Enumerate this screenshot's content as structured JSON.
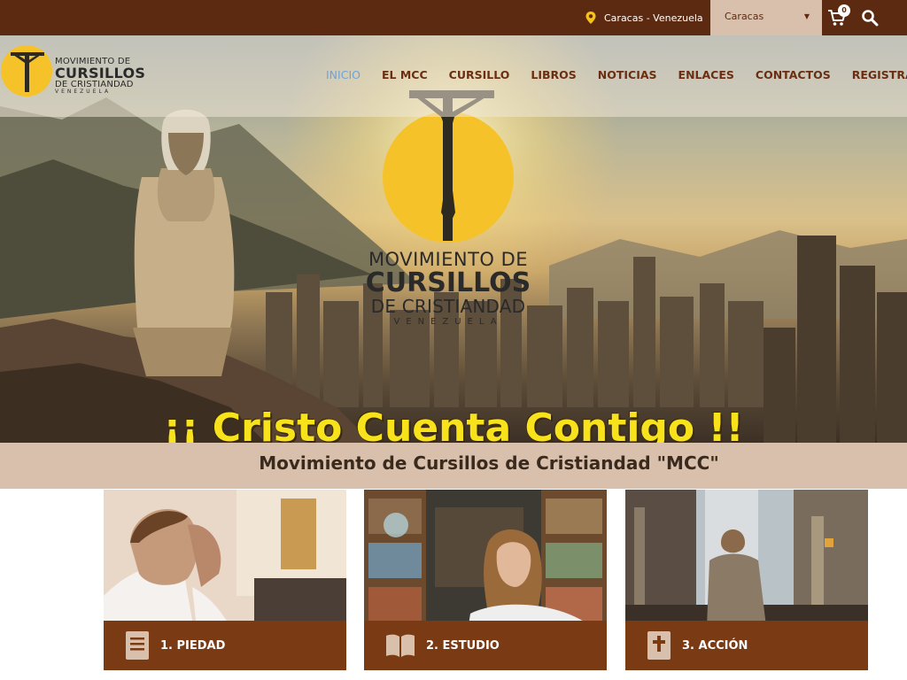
{
  "topbar": {
    "location": "Caracas - Venezuela",
    "location_icon": "map-pin-icon",
    "city_select": "Caracas",
    "cart_count": "0",
    "cart_icon": "cart-icon",
    "search_icon": "search-icon"
  },
  "logo": {
    "line1": "MOVIMIENTO DE",
    "line2": "CURSILLOS",
    "line3": "DE CRISTIANDAD",
    "line4": "VENEZUELA"
  },
  "nav": {
    "items": [
      {
        "label": "INICIO",
        "active": true
      },
      {
        "label": "EL MCC"
      },
      {
        "label": "CURSILLO"
      },
      {
        "label": "LIBROS"
      },
      {
        "label": "NOTICIAS"
      },
      {
        "label": "ENLACES"
      },
      {
        "label": "CONTACTOS"
      },
      {
        "label": "REGISTRATE"
      }
    ]
  },
  "hero": {
    "logo_line1": "MOVIMIENTO DE",
    "logo_line2": "CURSILLOS",
    "logo_line3": "DE CRISTIANDAD",
    "logo_line4": "VENEZUELA",
    "tagline": "¡¡ Cristo Cuenta Contigo !!",
    "slides": 4,
    "active_slide": 1
  },
  "section": {
    "title": "Movimiento de Cursillos de Cristiandad \"MCC\""
  },
  "cards": [
    {
      "label": "1. PIEDAD",
      "icon": "book-icon"
    },
    {
      "label": "2. ESTUDIO",
      "icon": "open-book-icon"
    },
    {
      "label": "3. ACCIÓN",
      "icon": "bible-cross-icon"
    }
  ],
  "colors": {
    "brand_dark": "#5c2a10",
    "card_bar": "#7a3a14",
    "strip": "#d8c0ad",
    "nav_active": "#6fa3d8",
    "tagline": "#f7e21b",
    "sun": "#f6c22a"
  }
}
